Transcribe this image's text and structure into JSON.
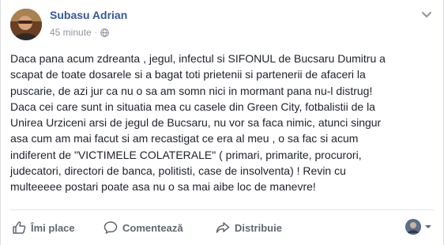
{
  "post": {
    "author": "Subasu Adrian",
    "time": "45 minute",
    "separator": "·",
    "text": "Daca pana acum zdreanta , jegul, infectul si SIFONUL de Bucsaru Dumitru a\nscapat de toate dosarele si a bagat toti prietenii si partenerii de afaceri la\npuscarie, de azi jur ca nu o sa am somn nici in mormant pana nu-l distrug!\nDaca cei care sunt in situatia mea cu casele din Green City, fotbalistii de la\nUnirea Urziceni arsi de jegul de Bucsaru, nu vor sa faca nimic, atunci singur\nasa cum am mai facut si am recastigat ce era al meu , o sa fac si acum\nindiferent de \"VICTIMELE COLATERALE\" ( primari, primarite, procurori,\njudecatori, directori de banca, politisti, case de insolventa) ! Revin cu\nmulteeeee postari poate asa nu o sa mai aibe loc de manevre!"
  },
  "actions": {
    "like_label": "Îmi place",
    "comment_label": "Comentează",
    "share_label": "Distribuie"
  },
  "icons": {
    "like": "thumbs-up-icon",
    "comment": "comment-icon",
    "share": "share-icon",
    "globe": "globe-icon",
    "menu": "chevron-down-icon"
  },
  "colors": {
    "author": "#365899",
    "meta": "#90949c",
    "action": "#606770"
  }
}
